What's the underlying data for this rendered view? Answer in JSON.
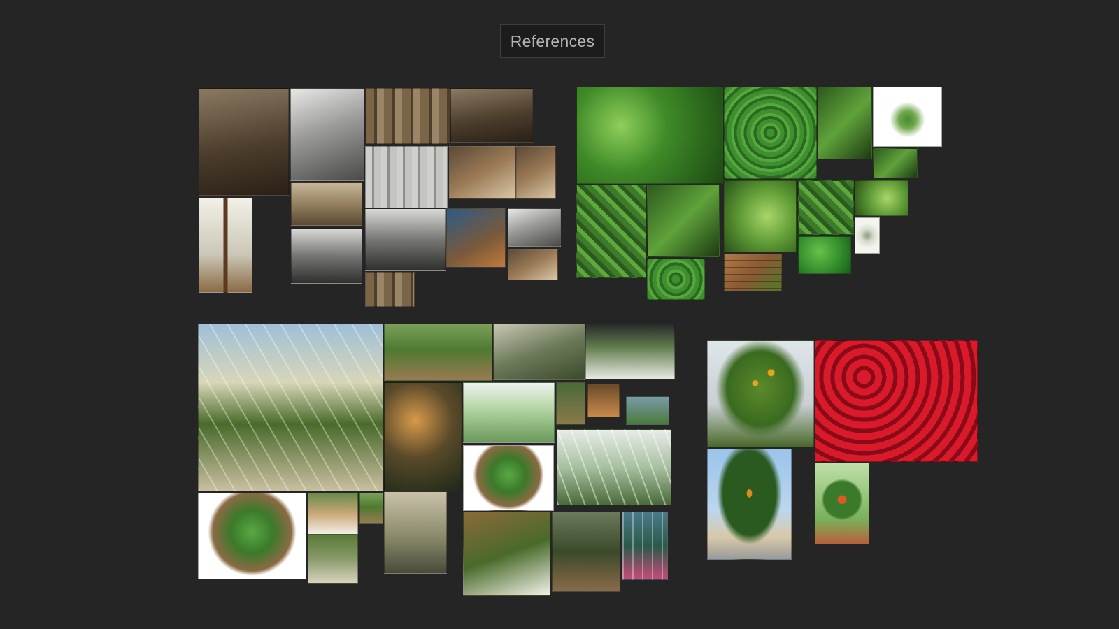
{
  "board": {
    "title": "References",
    "background": "#252525"
  }
}
